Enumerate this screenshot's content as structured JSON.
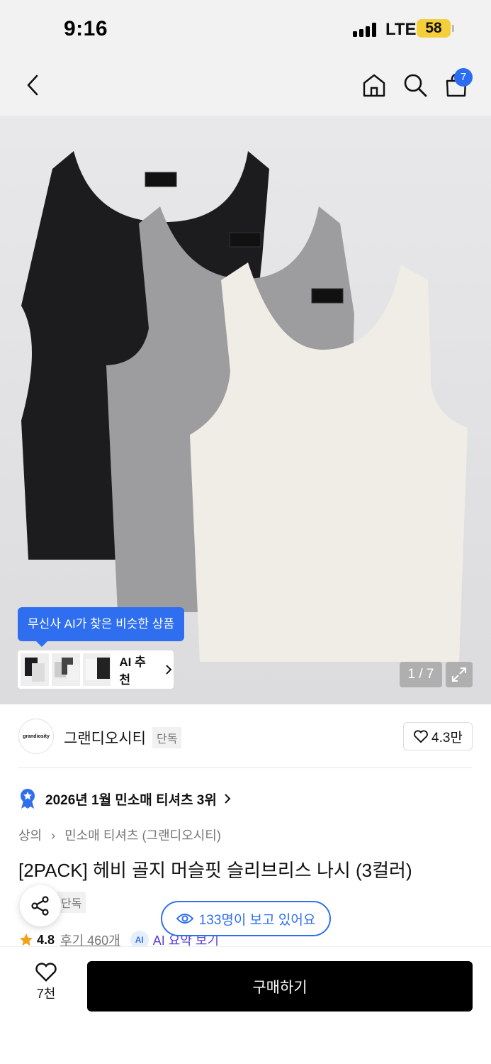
{
  "status_bar": {
    "time": "9:16",
    "network": "LTE",
    "battery": "58"
  },
  "nav": {
    "cart_count": "7"
  },
  "hero": {
    "ai_tooltip": "무신사 AI가 찾은 비슷한 상품",
    "ai_recommend_label": "AI 추천",
    "image_counter": "1 / 7",
    "product_colors": [
      "#1c1c1e",
      "#9c9c9c",
      "#efede6"
    ]
  },
  "brand": {
    "logo_text": "grandiosity",
    "name": "그랜디오시티",
    "tag": "단독",
    "likes": "4.3만"
  },
  "ranking": {
    "text": "2026년 1월 민소매 티셔츠 3위"
  },
  "breadcrumb": {
    "level1": "상의",
    "level2": "민소매 티셔츠 (그랜디오시티)"
  },
  "product": {
    "title": "[2PACK] 헤비 골지 머슬핏 슬리브리스 나시 (3컬러)",
    "tag": "단독",
    "rating": "4.8",
    "reviews": "후기 460개",
    "ai_badge": "AI",
    "ai_summary": "AI 요약 보기"
  },
  "viewing": {
    "text": "133명이 보고 있어요"
  },
  "bottom": {
    "likes": "7천",
    "buy_label": "구매하기"
  },
  "colors": {
    "accent": "#2f6fef",
    "buy_button": "#000000",
    "cart_badge": "#2a6cf2"
  }
}
